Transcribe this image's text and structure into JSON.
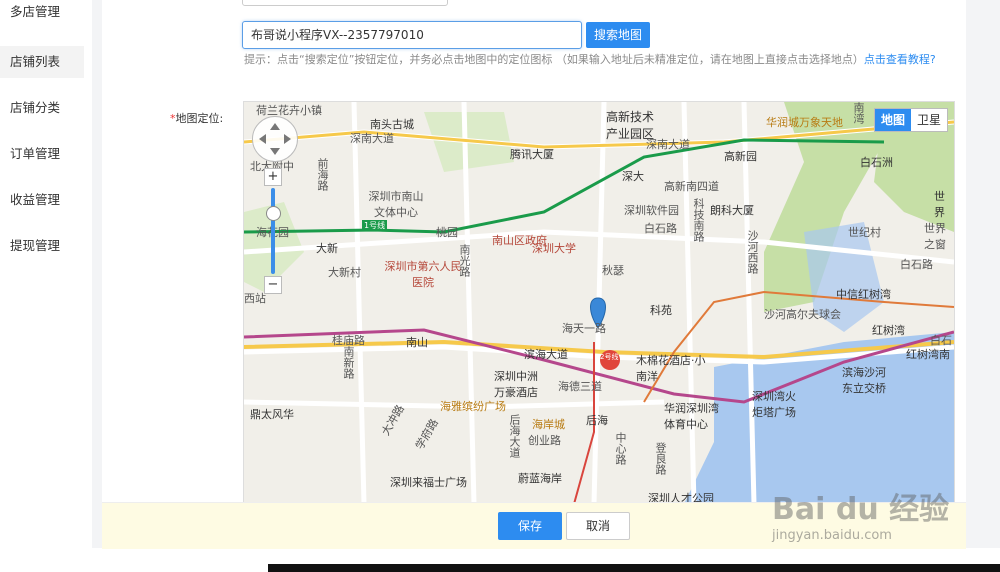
{
  "sidebar": {
    "items": [
      {
        "label": "多店管理"
      },
      {
        "label": "店铺列表"
      },
      {
        "label": "店铺分类"
      },
      {
        "label": "订单管理"
      },
      {
        "label": "收益管理"
      },
      {
        "label": "提现管理"
      }
    ],
    "active_index": 1
  },
  "form": {
    "search_value": "布哥说小程序VX--2357797010",
    "search_button": "搜索地图",
    "tip_text": "提示：点击“搜索定位”按钮定位，并务必点击地图中的定位图标 （如果输入地址后未精准定位，请在地图上直接点击选择地点）",
    "tip_link": "点击查看教程?",
    "map_label": "地图定位:",
    "required_mark": "*"
  },
  "map": {
    "type_map": "地图",
    "type_satellite": "卫星",
    "zoom_in": "+",
    "zoom_out": "−",
    "places": [
      "荷兰花卉小镇",
      "南头古城",
      "深南大道",
      "前海路",
      "深圳市南山文体中心",
      "海花园",
      "大新",
      "大新村",
      "桃园",
      "1号线",
      "南山区政府",
      "深圳市第六人民医院",
      "深圳大学",
      "腾讯大厦",
      "高新技术产业园区",
      "深大",
      "深南大道",
      "高新园",
      "南湾",
      "华润城万象天地",
      "白石洲",
      "世界",
      "世纪村",
      "世界之窗",
      "高新南四道",
      "朗科大厦",
      "深圳软件园",
      "白石路",
      "科技南路",
      "沙河西路",
      "白石路",
      "中信红树湾",
      "红树湾",
      "沙河高尔夫球会",
      "红树湾南",
      "北大附中",
      "西站",
      "桂庙路",
      "南山",
      "南光路",
      "秋瑟",
      "科苑",
      "海天一路",
      "滨海大道",
      "木棉花酒店·小南洋",
      "深圳中洲万豪酒店",
      "海德三道",
      "后海",
      "滨海沙河东立交桥",
      "深圳湾火炬塔广场",
      "华润深圳湾体育中心",
      "鼎太风华",
      "海雅缤纷广场",
      "海岸城",
      "后海大道",
      "创业路",
      "中心路",
      "登良路",
      "深圳来福士广场",
      "蔚蓝海岸",
      "深圳人才公园",
      "南新路",
      "大冲路",
      "学府路",
      "白石",
      "2号线"
    ]
  },
  "footer": {
    "save": "保存",
    "cancel": "取消"
  },
  "watermark": {
    "logo": "Bai du 经验",
    "url": "jingyan.baidu.com"
  },
  "colors": {
    "primary": "#2d8cf0",
    "footer_bg": "#fefbe3",
    "map_bg": "#f1efe9",
    "water": "#a8c8ef",
    "green": "#c6dfa6"
  }
}
